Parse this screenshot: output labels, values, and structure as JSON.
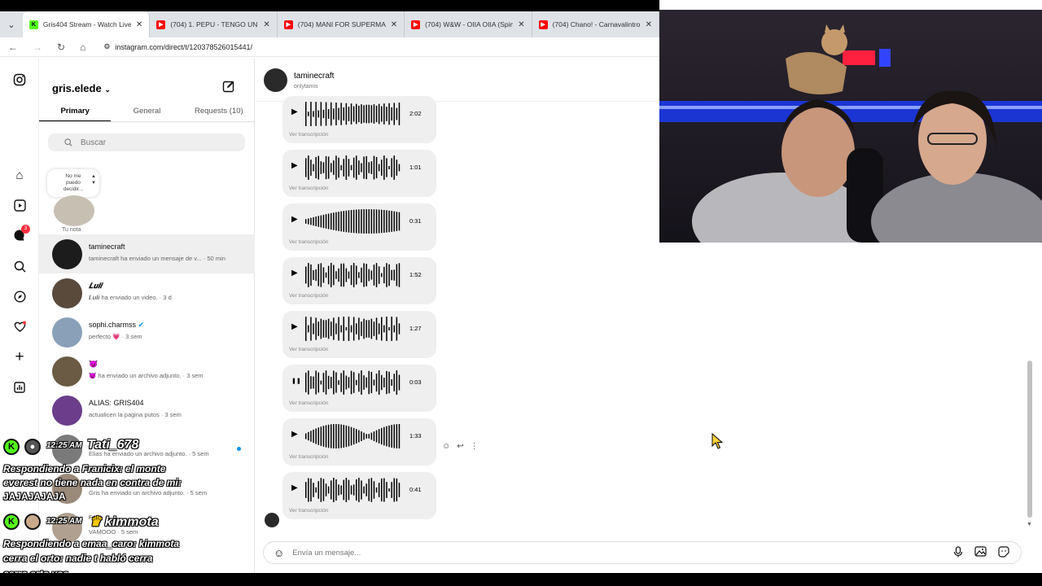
{
  "browser": {
    "tabs": [
      {
        "title": "Gris404 Stream - Watch Live on",
        "favicon": "kick-icon",
        "color": "#53fc18",
        "active": true
      },
      {
        "title": "(704) 1. PEPU - TENGO UN FEE",
        "favicon": "youtube-icon",
        "color": "#ff0000",
        "active": false
      },
      {
        "title": "(704) MANI FOR SUPERMARKE",
        "favicon": "youtube-icon",
        "color": "#ff0000",
        "active": false
      },
      {
        "title": "(704) W&W - OIIA OIIA (Spinn",
        "favicon": "youtube-icon",
        "color": "#ff0000",
        "active": false
      },
      {
        "title": "(704) Chano! - Carnavalintro - Y",
        "favicon": "youtube-icon",
        "color": "#ff0000",
        "active": false
      }
    ],
    "url": "instagram.com/direct/t/120378526015441/"
  },
  "sidebar": {
    "username": "gris.elede",
    "tabs": {
      "primary": "Primary",
      "general": "General",
      "requests": "Requests (10)"
    },
    "search_placeholder": "Buscar",
    "note": {
      "text_line1": "No me",
      "text_line2": "puedo",
      "text_line3": "decidir...",
      "label": "Tu nota"
    },
    "notification_count": "3",
    "conversations": [
      {
        "name": "taminecraft",
        "preview": "taminecraft ha enviado un mensaje de v... · 50 min",
        "selected": true,
        "avatar_color": "#1c1c1c"
      },
      {
        "name": "𝑳𝒖𝒍𝒊",
        "preview": "𝑳𝒖𝒍𝒊 ha enviado un video. · 3 d",
        "selected": false,
        "avatar_color": "#5a4a3c"
      },
      {
        "name": "sophi.charmss",
        "preview": "perfecto 💗 · 3 sem",
        "selected": false,
        "avatar_color": "#8aa0b8",
        "verified": true
      },
      {
        "name": "👿",
        "preview": "👿 ha enviado un archivo adjunto. · 3 sem",
        "selected": false,
        "avatar_color": "#6b5a44"
      },
      {
        "name": "ALIAS: GRIS404",
        "preview": "actualicen la pagina putos · 3 sem",
        "selected": false,
        "avatar_color": "#6b3d8a"
      },
      {
        "name": "",
        "preview": "Elias ha enviado un archivo adjunto. · 5 sem",
        "selected": false,
        "avatar_color": "#7a7a7a"
      },
      {
        "name": "",
        "preview": "Gris ha enviado un archivo adjunto. · 5 sem",
        "selected": false,
        "avatar_color": "#9a8a7a"
      },
      {
        "name": "Franja",
        "preview": "VAMOOO · 5 sem",
        "selected": false,
        "avatar_color": "#b0a090"
      }
    ]
  },
  "chat": {
    "name": "taminecraft",
    "subtitle": "onlytamis",
    "voice_messages": [
      {
        "duration": "2:02",
        "state": "play",
        "transcript_label": "Ver transcripción"
      },
      {
        "duration": "1:01",
        "state": "play",
        "transcript_label": "Ver transcripción"
      },
      {
        "duration": "0:31",
        "state": "play",
        "transcript_label": "Ver transcripción"
      },
      {
        "duration": "1:52",
        "state": "play",
        "transcript_label": "Ver transcripción"
      },
      {
        "duration": "1:27",
        "state": "play",
        "transcript_label": "Ver transcripción"
      },
      {
        "duration": "0:03",
        "state": "pause",
        "transcript_label": "Ver transcripción"
      },
      {
        "duration": "1:33",
        "state": "play",
        "transcript_label": "Ver transcripción"
      },
      {
        "duration": "0:41",
        "state": "play",
        "transcript_label": "Ver transcripción"
      }
    ],
    "message_placeholder": "Envía un mensaje..."
  },
  "stream_chat": {
    "lines": [
      {
        "time": "12:25 AM",
        "user": "Tati_678",
        "text": ""
      },
      {
        "text": "Respondiendo a Franicix: el monte"
      },
      {
        "text": "everest no tiene nada en contra de mi:"
      },
      {
        "text": "JAJAJAJAJA"
      },
      {
        "time": "12:25 AM",
        "user": "kimmota",
        "text": ""
      },
      {
        "text": "Respondiendo a emaa_caro: kimmota"
      },
      {
        "text": "cerra el orto:  nadie t habló cerra"
      },
      {
        "text": "cerra orto vos"
      }
    ]
  },
  "colors": {
    "accent": "#0095f6",
    "notification": "#ff3040",
    "kick": "#53fc18"
  }
}
